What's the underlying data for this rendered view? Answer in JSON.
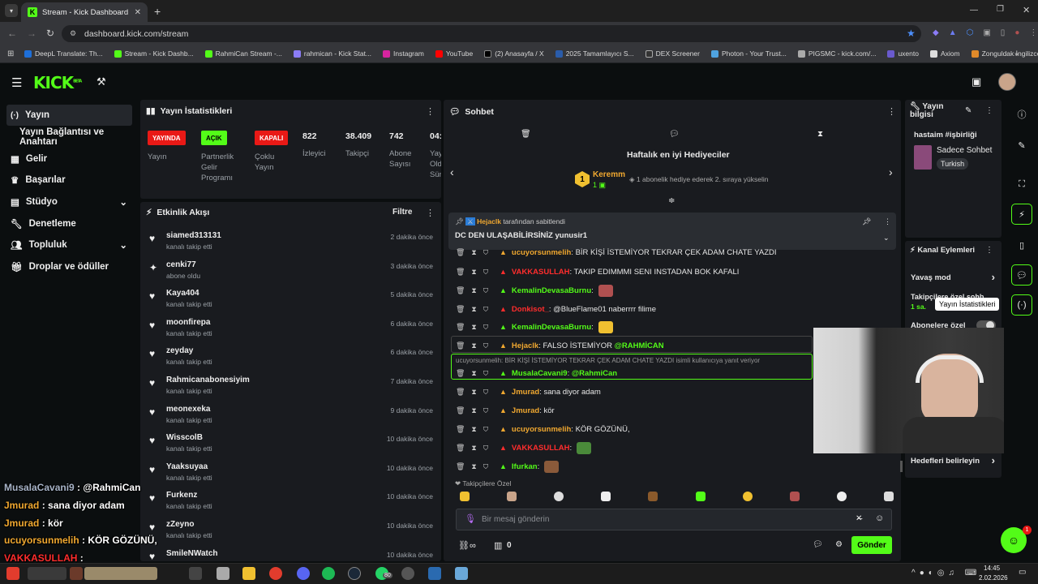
{
  "browser": {
    "tab_title": "Stream - Kick Dashboard",
    "url": "dashboard.kick.com/stream",
    "bookmarks": [
      "DeepL Translate: Th...",
      "Stream - Kick Dashb...",
      "RahmiCan Stream -...",
      "rahmican - Kick Stat...",
      "Instagram",
      "YouTube",
      "(2) Anasayfa / X",
      "2025 Tamamlayıcı S...",
      "DEX Screener",
      "Photon - Your Trust...",
      "PIGSMC - kick.com/...",
      "uxento",
      "Axiom",
      "Zonguldak İngilizce..."
    ]
  },
  "logo": {
    "text": "KICK",
    "sup": "BETA"
  },
  "sidebar": {
    "items": [
      {
        "label": "Yayın",
        "icon": "broadcast-icon"
      },
      {
        "label": "Yayın Bağlantısı ve Anahtarı",
        "icon": ""
      },
      {
        "label": "Gelir",
        "icon": "money-icon"
      },
      {
        "label": "Başarılar",
        "icon": "trophy-icon"
      },
      {
        "label": "Stüdyo",
        "icon": "studio-icon"
      },
      {
        "label": "Denetleme",
        "icon": "wrench-icon"
      },
      {
        "label": "Topluluk",
        "icon": "users-icon"
      },
      {
        "label": "Droplar ve ödüller",
        "icon": "gift-icon"
      }
    ]
  },
  "stats": {
    "title": "Yayın İstatistikleri",
    "badges": [
      {
        "text": "YAYINDA",
        "label": "Yayın",
        "color": "#e91916"
      },
      {
        "text": "AÇIK",
        "label": "Partnerlik Gelir Programı",
        "color": "#53fc18"
      },
      {
        "text": "KAPALI",
        "label": "Çoklu Yayın",
        "color": "#e91916"
      }
    ],
    "numbers": [
      {
        "value": "822",
        "label": "İzleyici"
      },
      {
        "value": "38.409",
        "label": "Takipçi"
      },
      {
        "value": "742",
        "label": "Abone Sayısı"
      },
      {
        "value": "04:",
        "label": "Yay Old Sür"
      }
    ]
  },
  "activity": {
    "title": "Etkinlik Akışı",
    "filter": "Filtre",
    "events": [
      {
        "name": "siamed313131",
        "action": "kanalı takip etti",
        "time": "2 dakika önce",
        "icon": "heart-icon"
      },
      {
        "name": "cenki77",
        "action": "abone oldu",
        "time": "3 dakika önce",
        "icon": "star-icon"
      },
      {
        "name": "Kaya404",
        "action": "kanalı takip etti",
        "time": "5 dakika önce",
        "icon": "heart-icon"
      },
      {
        "name": "moonfirepa",
        "action": "kanalı takip etti",
        "time": "6 dakika önce",
        "icon": "heart-icon"
      },
      {
        "name": "zeyday",
        "action": "kanalı takip etti",
        "time": "6 dakika önce",
        "icon": "heart-icon"
      },
      {
        "name": "Rahmicanabonesiyim",
        "action": "kanalı takip etti",
        "time": "7 dakika önce",
        "icon": "heart-icon"
      },
      {
        "name": "meonexeka",
        "action": "kanalı takip etti",
        "time": "9 dakika önce",
        "icon": "heart-icon"
      },
      {
        "name": "WisscolB",
        "action": "kanalı takip etti",
        "time": "10 dakika önce",
        "icon": "heart-icon"
      },
      {
        "name": "Yaaksuyaa",
        "action": "kanalı takip etti",
        "time": "10 dakika önce",
        "icon": "heart-icon"
      },
      {
        "name": "Furkenz",
        "action": "kanalı takip etti",
        "time": "10 dakika önce",
        "icon": "heart-icon"
      },
      {
        "name": "zZeyno",
        "action": "kanalı takip etti",
        "time": "10 dakika önce",
        "icon": "heart-icon"
      },
      {
        "name": "SmileNWatch",
        "action": "",
        "time": "10 dakika önce",
        "icon": "heart-icon"
      }
    ]
  },
  "chat": {
    "title": "Sohbet",
    "gifters_title": "Haftalık en iyi Hediyeciler",
    "top_gifter": {
      "rank": "1",
      "name": "Keremm",
      "count": "1"
    },
    "gift_hint": "1 abonelik hediye ederek 2. sıraya yükselin",
    "pinned_by_user": "Hejaclk",
    "pinned_by_suffix": "tarafından sabitlendi",
    "pinned_text": "DC DEN ULAŞABİLİRSİNİZ yunusir1",
    "reply_hint": "ucuyorsunmelih: BİR KİŞİ İSTEMİYOR TEKRAR ÇEK ADAM CHATE YAZDI isimli kullanıcıya yanıt veriyor",
    "messages": [
      {
        "user": "ucuyorsunmelih",
        "color": "#f0a830",
        "text": ": BİR KİŞİ İSTEMİYOR TEKRAR ÇEK ADAM CHATE YAZDI"
      },
      {
        "user": "VAKKASULLAH",
        "color": "#ff2d2d",
        "text": ": TAKIP EDIMMMI SENI INSTADAN BOK KAFALI"
      },
      {
        "user": "KemalinDevasaBurnu",
        "color": "#53fc18",
        "text": ":"
      },
      {
        "user": "Donkisot_",
        "color": "#ff2d2d",
        "text": ": @BlueFlame01 naberrrr filime"
      },
      {
        "user": "KemalinDevasaBurnu",
        "color": "#53fc18",
        "text": ":"
      },
      {
        "user": "Hejaclk",
        "color": "#f0a830",
        "text": ": FALSO İSTEMİYOR",
        "mention": "@RAHMİCAN"
      },
      {
        "user": "MusalaCavani9",
        "color": "#53fc18",
        "text": ":",
        "mention": "@RahmiCan"
      },
      {
        "user": "Jmurad",
        "color": "#f0a830",
        "text": ": sana diyor adam"
      },
      {
        "user": "Jmurad",
        "color": "#f0a830",
        "text": ": kör"
      },
      {
        "user": "ucuyorsunmelih",
        "color": "#f0a830",
        "text": ": KÖR GÖZÜNÜ,"
      },
      {
        "user": "VAKKASULLAH",
        "color": "#ff2d2d",
        "text": ":"
      },
      {
        "user": "Ifurkan",
        "color": "#53fc18",
        "text": ":"
      }
    ],
    "followers_only": "Takipçilere Özel",
    "input_placeholder": "Bir mesaj gönderin",
    "counter": "0",
    "send_label": "Gönder"
  },
  "stream_info": {
    "title": "Yayın bilgisi",
    "stream_title": "hastaim #işbirliği",
    "category": "Sadece Sohbet",
    "language": "Turkish"
  },
  "channel_actions": {
    "title": "Kanal Eylemleri",
    "slow_mode": "Yavaş mod",
    "followers_label": "Takipçilere özel sohb",
    "followers_value": "1 sa.",
    "subs_label": "Abonelere özel",
    "goals": "Hedefleri belirleyin",
    "tooltip": "Yayın İstatistikleri"
  },
  "overlay_chat": [
    {
      "user": "MusalaCavani9",
      "color": "#a8b4c8",
      "text": " : @RahmiCan"
    },
    {
      "user": "Jmurad",
      "color": "#f0a830",
      "text": " : sana diyor adam"
    },
    {
      "user": "Jmurad",
      "color": "#f0a830",
      "text": " : kör"
    },
    {
      "user": "ucuyorsunmelih",
      "color": "#f0a830",
      "text": " : KÖR GÖZÜNÜ,"
    },
    {
      "user": "VAKKASULLAH",
      "color": "#ff2d2d",
      "text": " :"
    },
    {
      "user": "lfurkan",
      "color": "#53fc18",
      "text": " :"
    }
  ],
  "taskbar": {
    "time": "14:45",
    "date": "2.02.2026",
    "notification_count": "1",
    "whatsapp_badge": "80"
  },
  "colors": {
    "brand": "#53fc18",
    "panel": "#191b1f",
    "live": "#e91916"
  }
}
